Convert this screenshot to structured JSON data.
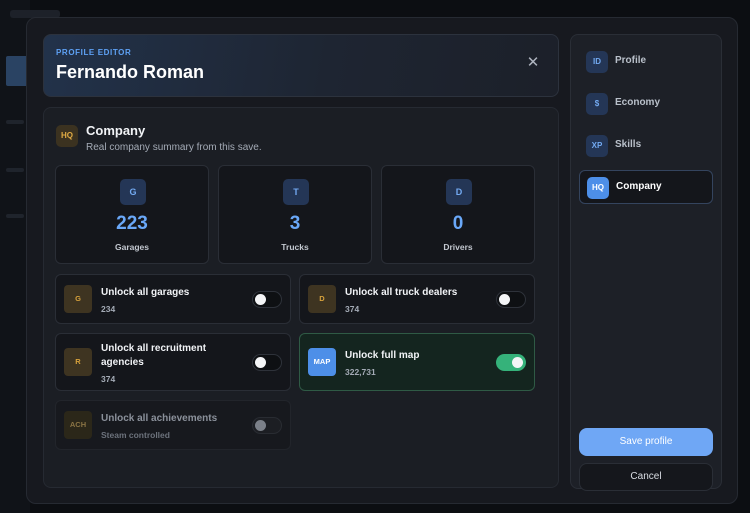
{
  "header": {
    "eyebrow": "PROFILE EDITOR",
    "title": "Fernando Roman"
  },
  "section": {
    "badge": "HQ",
    "title": "Company",
    "subtitle": "Real company summary from this save."
  },
  "stats": [
    {
      "badge": "G",
      "value": "223",
      "label": "Garages"
    },
    {
      "badge": "T",
      "value": "3",
      "label": "Trucks"
    },
    {
      "badge": "D",
      "value": "0",
      "label": "Drivers"
    }
  ],
  "toggles": [
    {
      "badge": "G",
      "title": "Unlock all garages",
      "value": "234",
      "state": "off"
    },
    {
      "badge": "D",
      "title": "Unlock all truck dealers",
      "value": "374",
      "state": "off"
    },
    {
      "badge": "R",
      "title": "Unlock all recruitment agencies",
      "value": "374",
      "state": "off"
    },
    {
      "badge": "MAP",
      "title": "Unlock full map",
      "value": "322,731",
      "state": "on"
    },
    {
      "badge": "ACH",
      "title": "Unlock all achievements",
      "value": "Steam controlled",
      "state": "disabled"
    }
  ],
  "nav": [
    {
      "badge": "ID",
      "label": "Profile"
    },
    {
      "badge": "$",
      "label": "Economy"
    },
    {
      "badge": "XP",
      "label": "Skills"
    },
    {
      "badge": "HQ",
      "label": "Company",
      "active": true
    }
  ],
  "buttons": {
    "save": "Save profile",
    "cancel": "Cancel"
  },
  "colors": {
    "accent": "#6fa7f5",
    "toggle_on": "#35b27a",
    "badge_amber": "#d7a23c"
  },
  "icons": {
    "close": "close-icon"
  }
}
